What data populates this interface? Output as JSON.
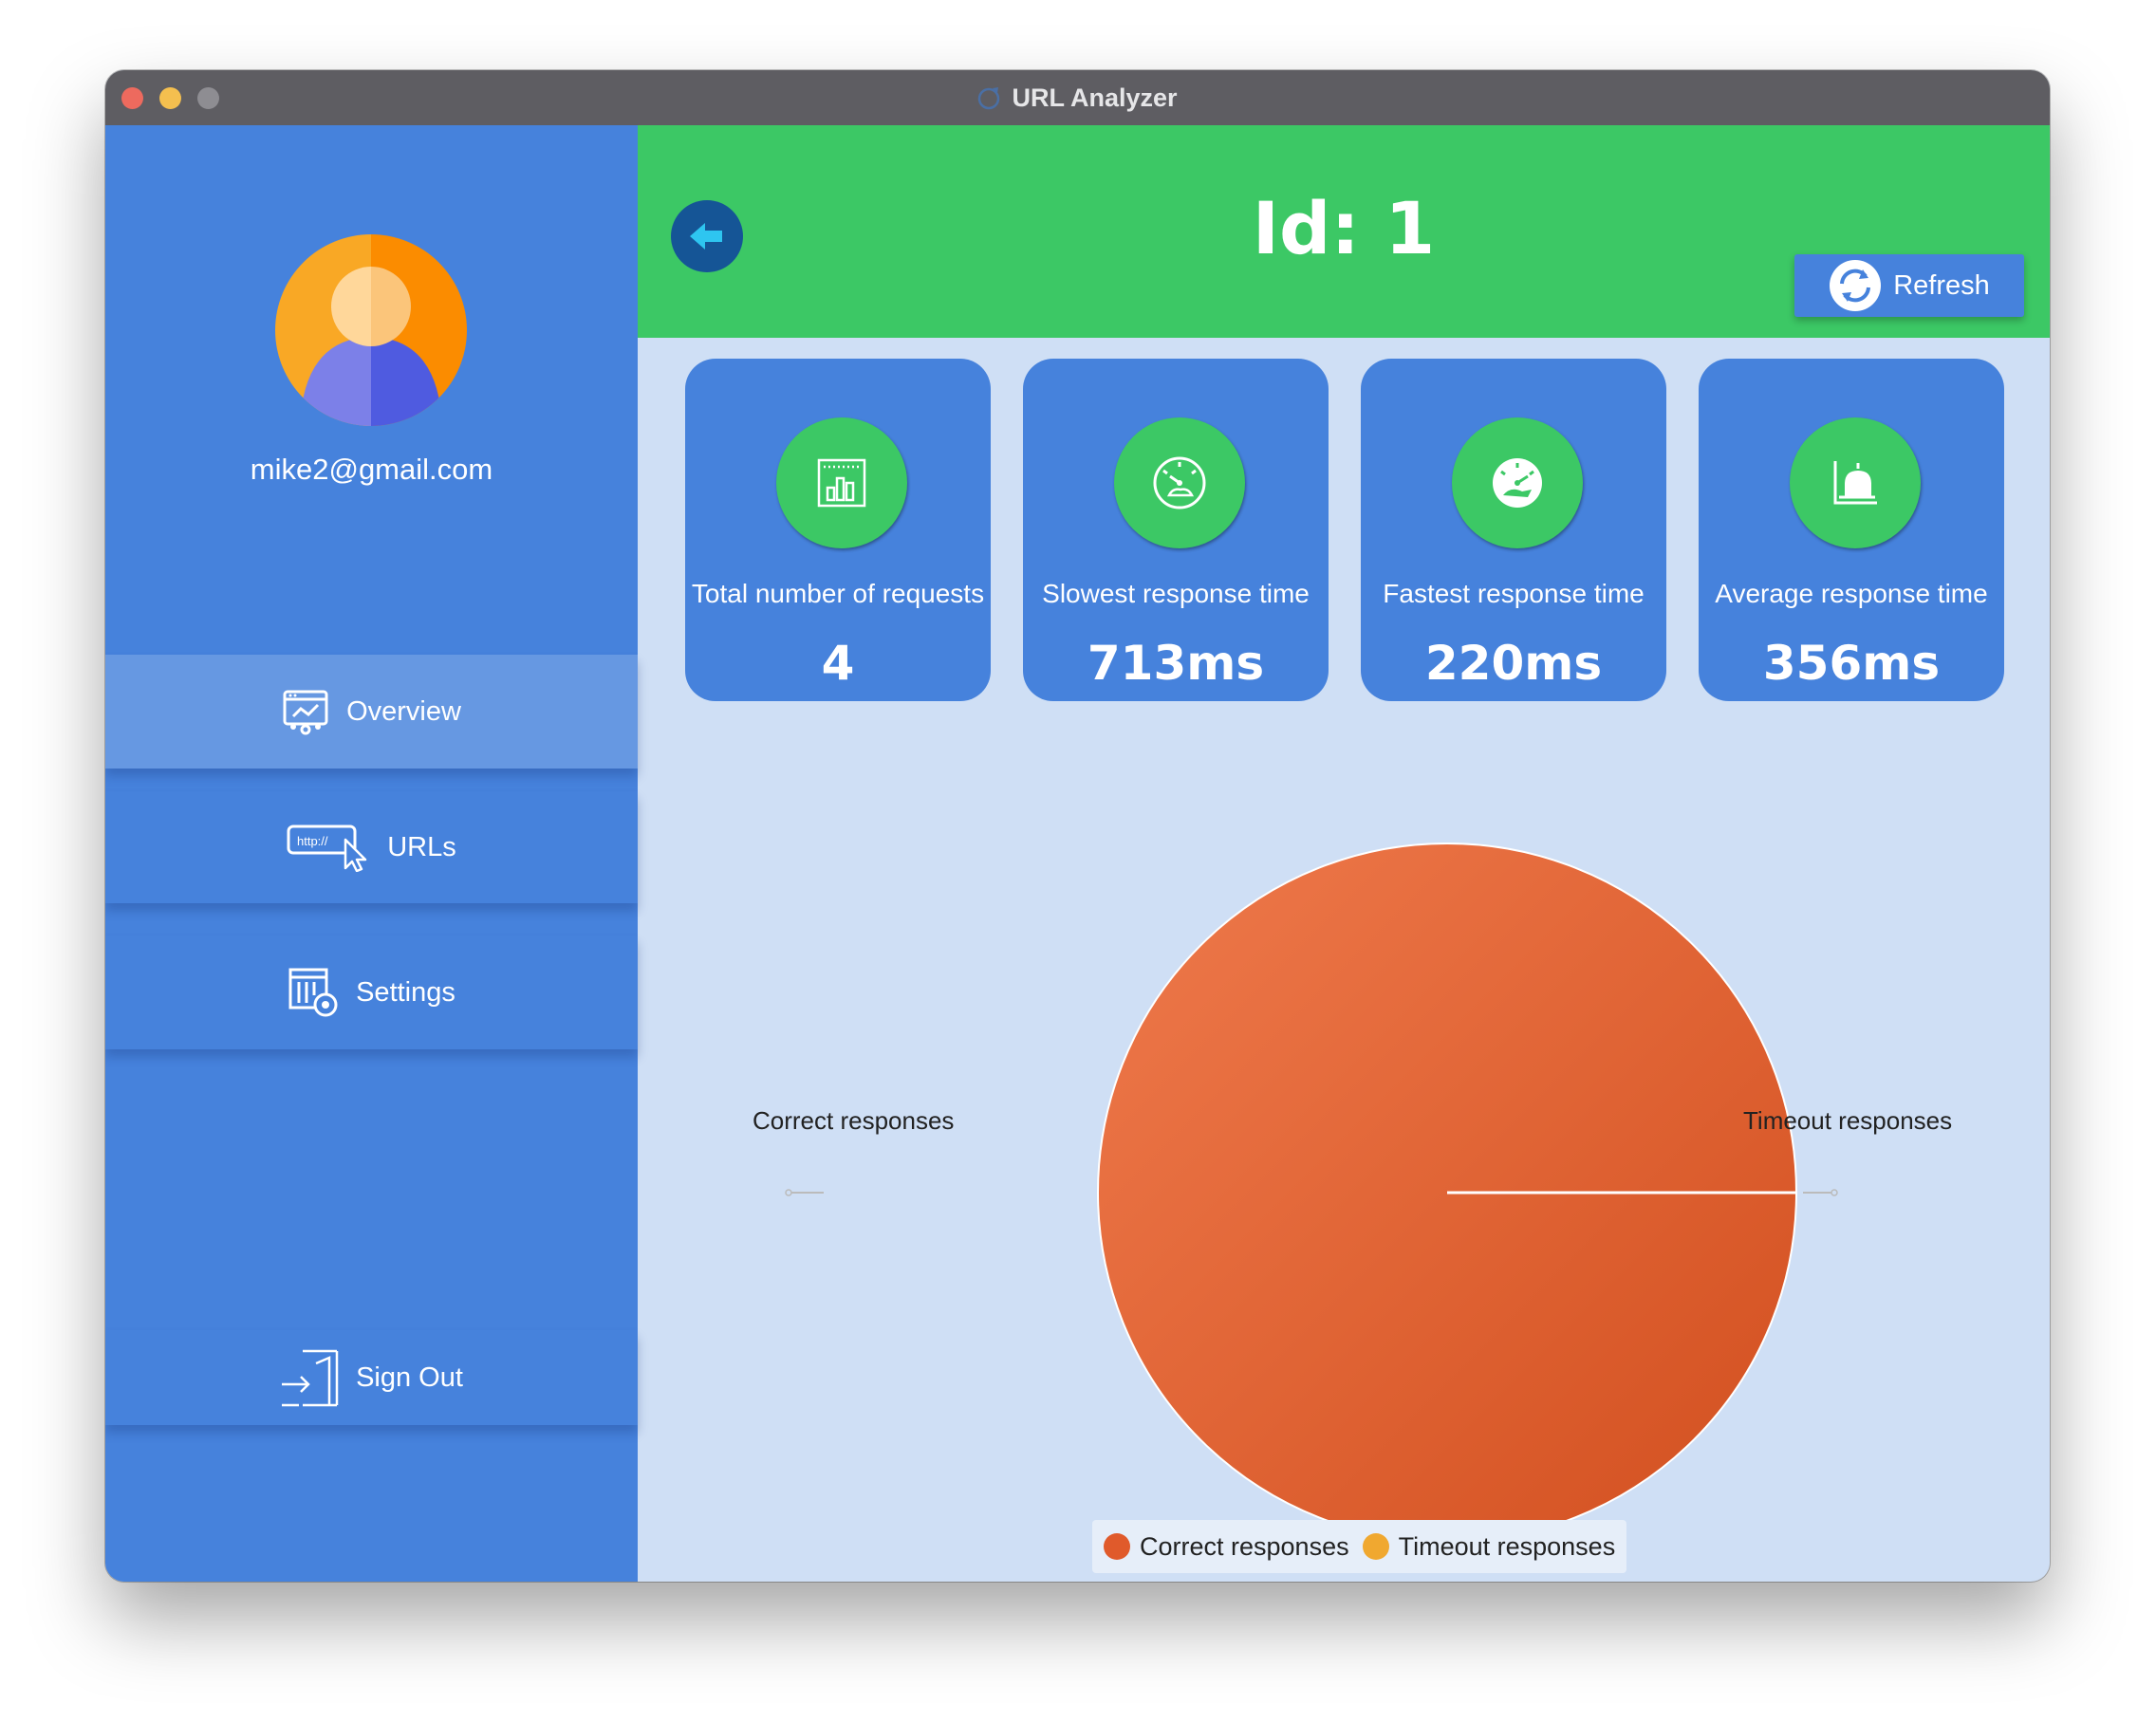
{
  "window": {
    "title": "URL Analyzer"
  },
  "sidebar": {
    "email": "mike2@gmail.com",
    "items": [
      {
        "label": "Overview",
        "icon": "dashboard-icon",
        "active": true
      },
      {
        "label": "URLs",
        "icon": "http-cursor-icon",
        "active": false
      },
      {
        "label": "Settings",
        "icon": "settings-gear-icon",
        "active": false
      }
    ],
    "sign_out": {
      "label": "Sign Out",
      "icon": "sign-out-icon"
    }
  },
  "header": {
    "title": "Id: 1",
    "refresh_label": "Refresh"
  },
  "cards": [
    {
      "label": "Total number of requests",
      "value": "4",
      "icon": "bar-chart-icon"
    },
    {
      "label": "Slowest response time",
      "value": "713ms",
      "icon": "slow-speedometer-icon"
    },
    {
      "label": "Fastest response time",
      "value": "220ms",
      "icon": "fast-speedometer-icon"
    },
    {
      "label": "Average response time",
      "value": "356ms",
      "icon": "average-chart-icon"
    }
  ],
  "chart_data": {
    "type": "pie",
    "slices": [
      {
        "name": "Correct responses",
        "value": 4,
        "color": "#e05a2b"
      },
      {
        "name": "Timeout responses",
        "value": 0,
        "color": "#f0a830"
      }
    ],
    "legend": [
      "Correct responses",
      "Timeout responses"
    ],
    "legend_position": "bottom"
  },
  "colors": {
    "sidebar": "#4682dc",
    "header": "#3cc865",
    "content_bg": "#cfdff5",
    "back_button": "#155596"
  }
}
